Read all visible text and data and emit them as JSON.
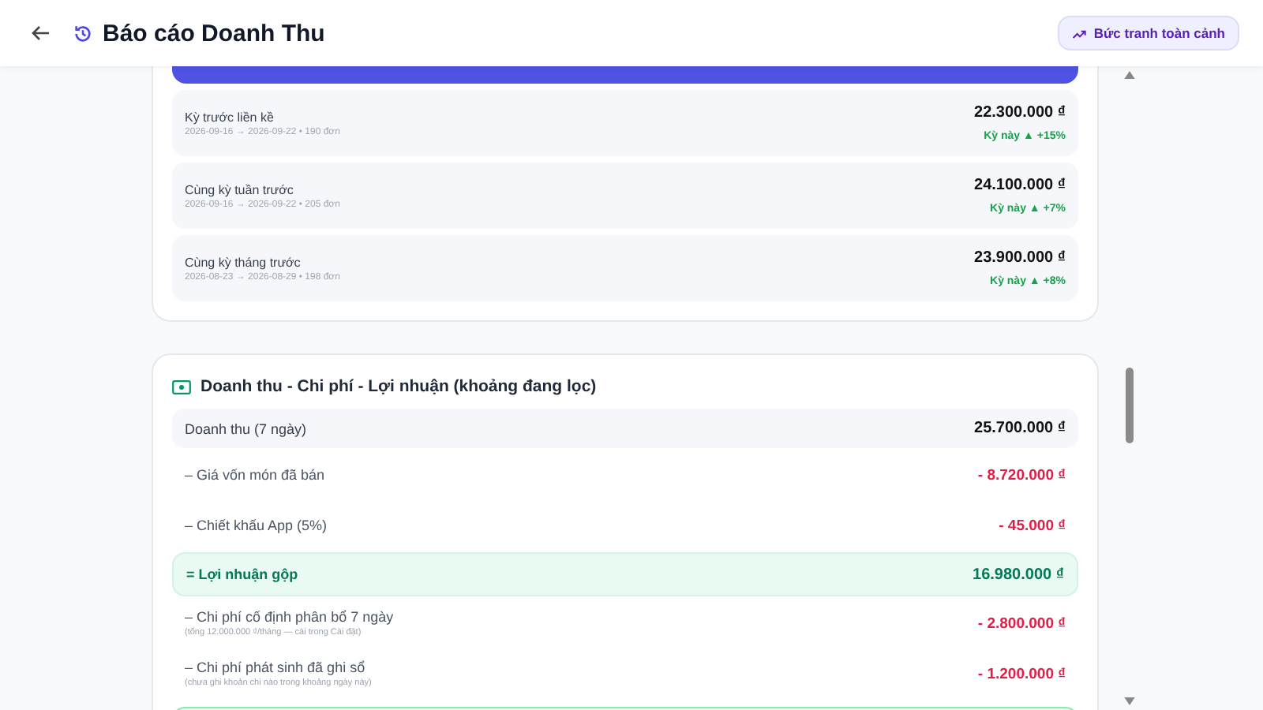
{
  "header": {
    "title": "Báo cáo Doanh Thu",
    "action_button": "Bức tranh toàn cảnh"
  },
  "comparison": {
    "rows": [
      {
        "label": "Kỳ trước liền kề",
        "range": "2026-09-16 → 2026-09-22 • 190 đơn",
        "amount": "22.300.000 ₫",
        "change": "Kỳ này ▲ +15%"
      },
      {
        "label": "Cùng kỳ tuần trước",
        "range": "2026-09-16 → 2026-09-22 • 205 đơn",
        "amount": "24.100.000 ₫",
        "change": "Kỳ này ▲ +7%"
      },
      {
        "label": "Cùng kỳ tháng trước",
        "range": "2026-08-23 → 2026-08-29 • 198 đơn",
        "amount": "23.900.000 ₫",
        "change": "Kỳ này ▲ +8%"
      }
    ]
  },
  "pnl": {
    "title": "Doanh thu - Chi phí - Lợi nhuận (khoảng đang lọc)",
    "rows": [
      {
        "kind": "revenue",
        "label": "Doanh thu (7 ngày)",
        "amount": "25.700.000 ₫"
      },
      {
        "kind": "deduction",
        "label": "– Giá vốn món đã bán",
        "amount": "- 8.720.000 ₫"
      },
      {
        "kind": "deduction",
        "label": "– Chiết khấu App (5%)",
        "amount": "- 45.000 ₫"
      },
      {
        "kind": "subtotal",
        "label": "= Lợi nhuận gộp",
        "amount": "16.980.000 ₫"
      },
      {
        "kind": "deduction",
        "label": "– Chi phí cố định phân bổ 7 ngày",
        "note": "(tổng 12.000.000 ₫/tháng — cài trong Cài đặt)",
        "amount": "- 2.800.000 ₫"
      },
      {
        "kind": "deduction",
        "label": "– Chi phí phát sinh đã ghi sổ",
        "note": "(chưa ghi khoản chi nào trong khoảng ngày này)",
        "amount": "- 1.200.000 ₫"
      }
    ]
  }
}
